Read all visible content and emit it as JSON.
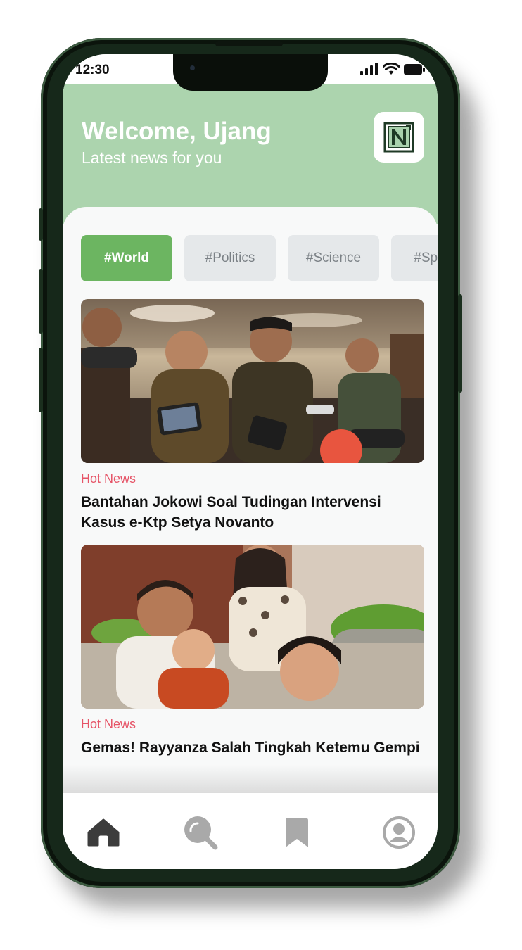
{
  "status_bar": {
    "time": "12:30"
  },
  "header": {
    "title": "Welcome, Ujang",
    "subtitle": "Latest news for you",
    "logo_letter": "N"
  },
  "categories": [
    "#World",
    "#Politics",
    "#Science",
    "#Sports"
  ],
  "active_category": "#World",
  "articles": [
    {
      "tag": "Hot News",
      "title": "Bantahan Jokowi Soal Tudingan Intervensi Kasus e-Ktp Setya Novanto"
    },
    {
      "tag": "Hot News",
      "title": "Gemas! Rayyanza Salah Tingkah Ketemu Gempi"
    }
  ],
  "bottom_nav": [
    {
      "icon": "home-icon",
      "active": true
    },
    {
      "icon": "search-icon",
      "active": false
    },
    {
      "icon": "bookmark-icon",
      "active": false
    },
    {
      "icon": "profile-icon",
      "active": false
    }
  ],
  "colors": {
    "header_bg": "#acd4ae",
    "accent": "#6cb561",
    "hot_tag": "#e65467",
    "nav_active": "#3c3c3c",
    "nav_inactive": "#a9a9a9"
  }
}
